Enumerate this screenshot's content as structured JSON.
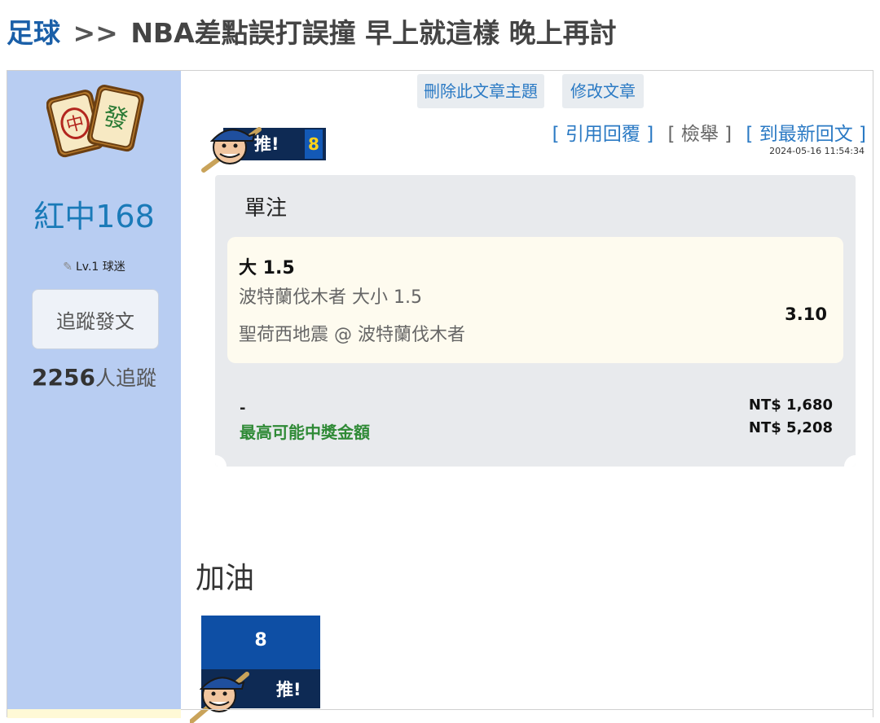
{
  "breadcrumb": {
    "category": "足球",
    "separator": ">>",
    "title": "NBA差點誤打誤撞 早上就這樣 晚上再討"
  },
  "author": {
    "name": "紅中168",
    "level": "Lv.1 球迷",
    "follow_button": "追蹤發文",
    "follower_count": "2256",
    "follower_suffix": "人追蹤"
  },
  "actions": {
    "delete": "刪除此文章主題",
    "edit": "修改文章",
    "quote": "[ 引用回覆 ]",
    "report": "[ 檢舉 ]",
    "latest": "[ 到最新回文 ]"
  },
  "timestamp": "2024-05-16 11:54:34",
  "push": {
    "label": "推!",
    "count": "8"
  },
  "bet_slip": {
    "title": "單注",
    "pick": "大 1.5",
    "market": "波特蘭伐木者 大小 1.5",
    "match": "聖荷西地震 @ 波特蘭伐木者",
    "odds": "3.10",
    "stake_label": "-",
    "stake": "NT$ 1,680",
    "max_label": "最高可能中獎金額",
    "max_payout": "NT$ 5,208"
  },
  "comment": "加油",
  "colors": {
    "sidebar": "#b8cdf2",
    "link": "#2b7ac4",
    "username": "#1a7ab8",
    "green": "#2f8a36",
    "push_navy": "#0e2a54",
    "push_blue": "#0e4fa5"
  }
}
